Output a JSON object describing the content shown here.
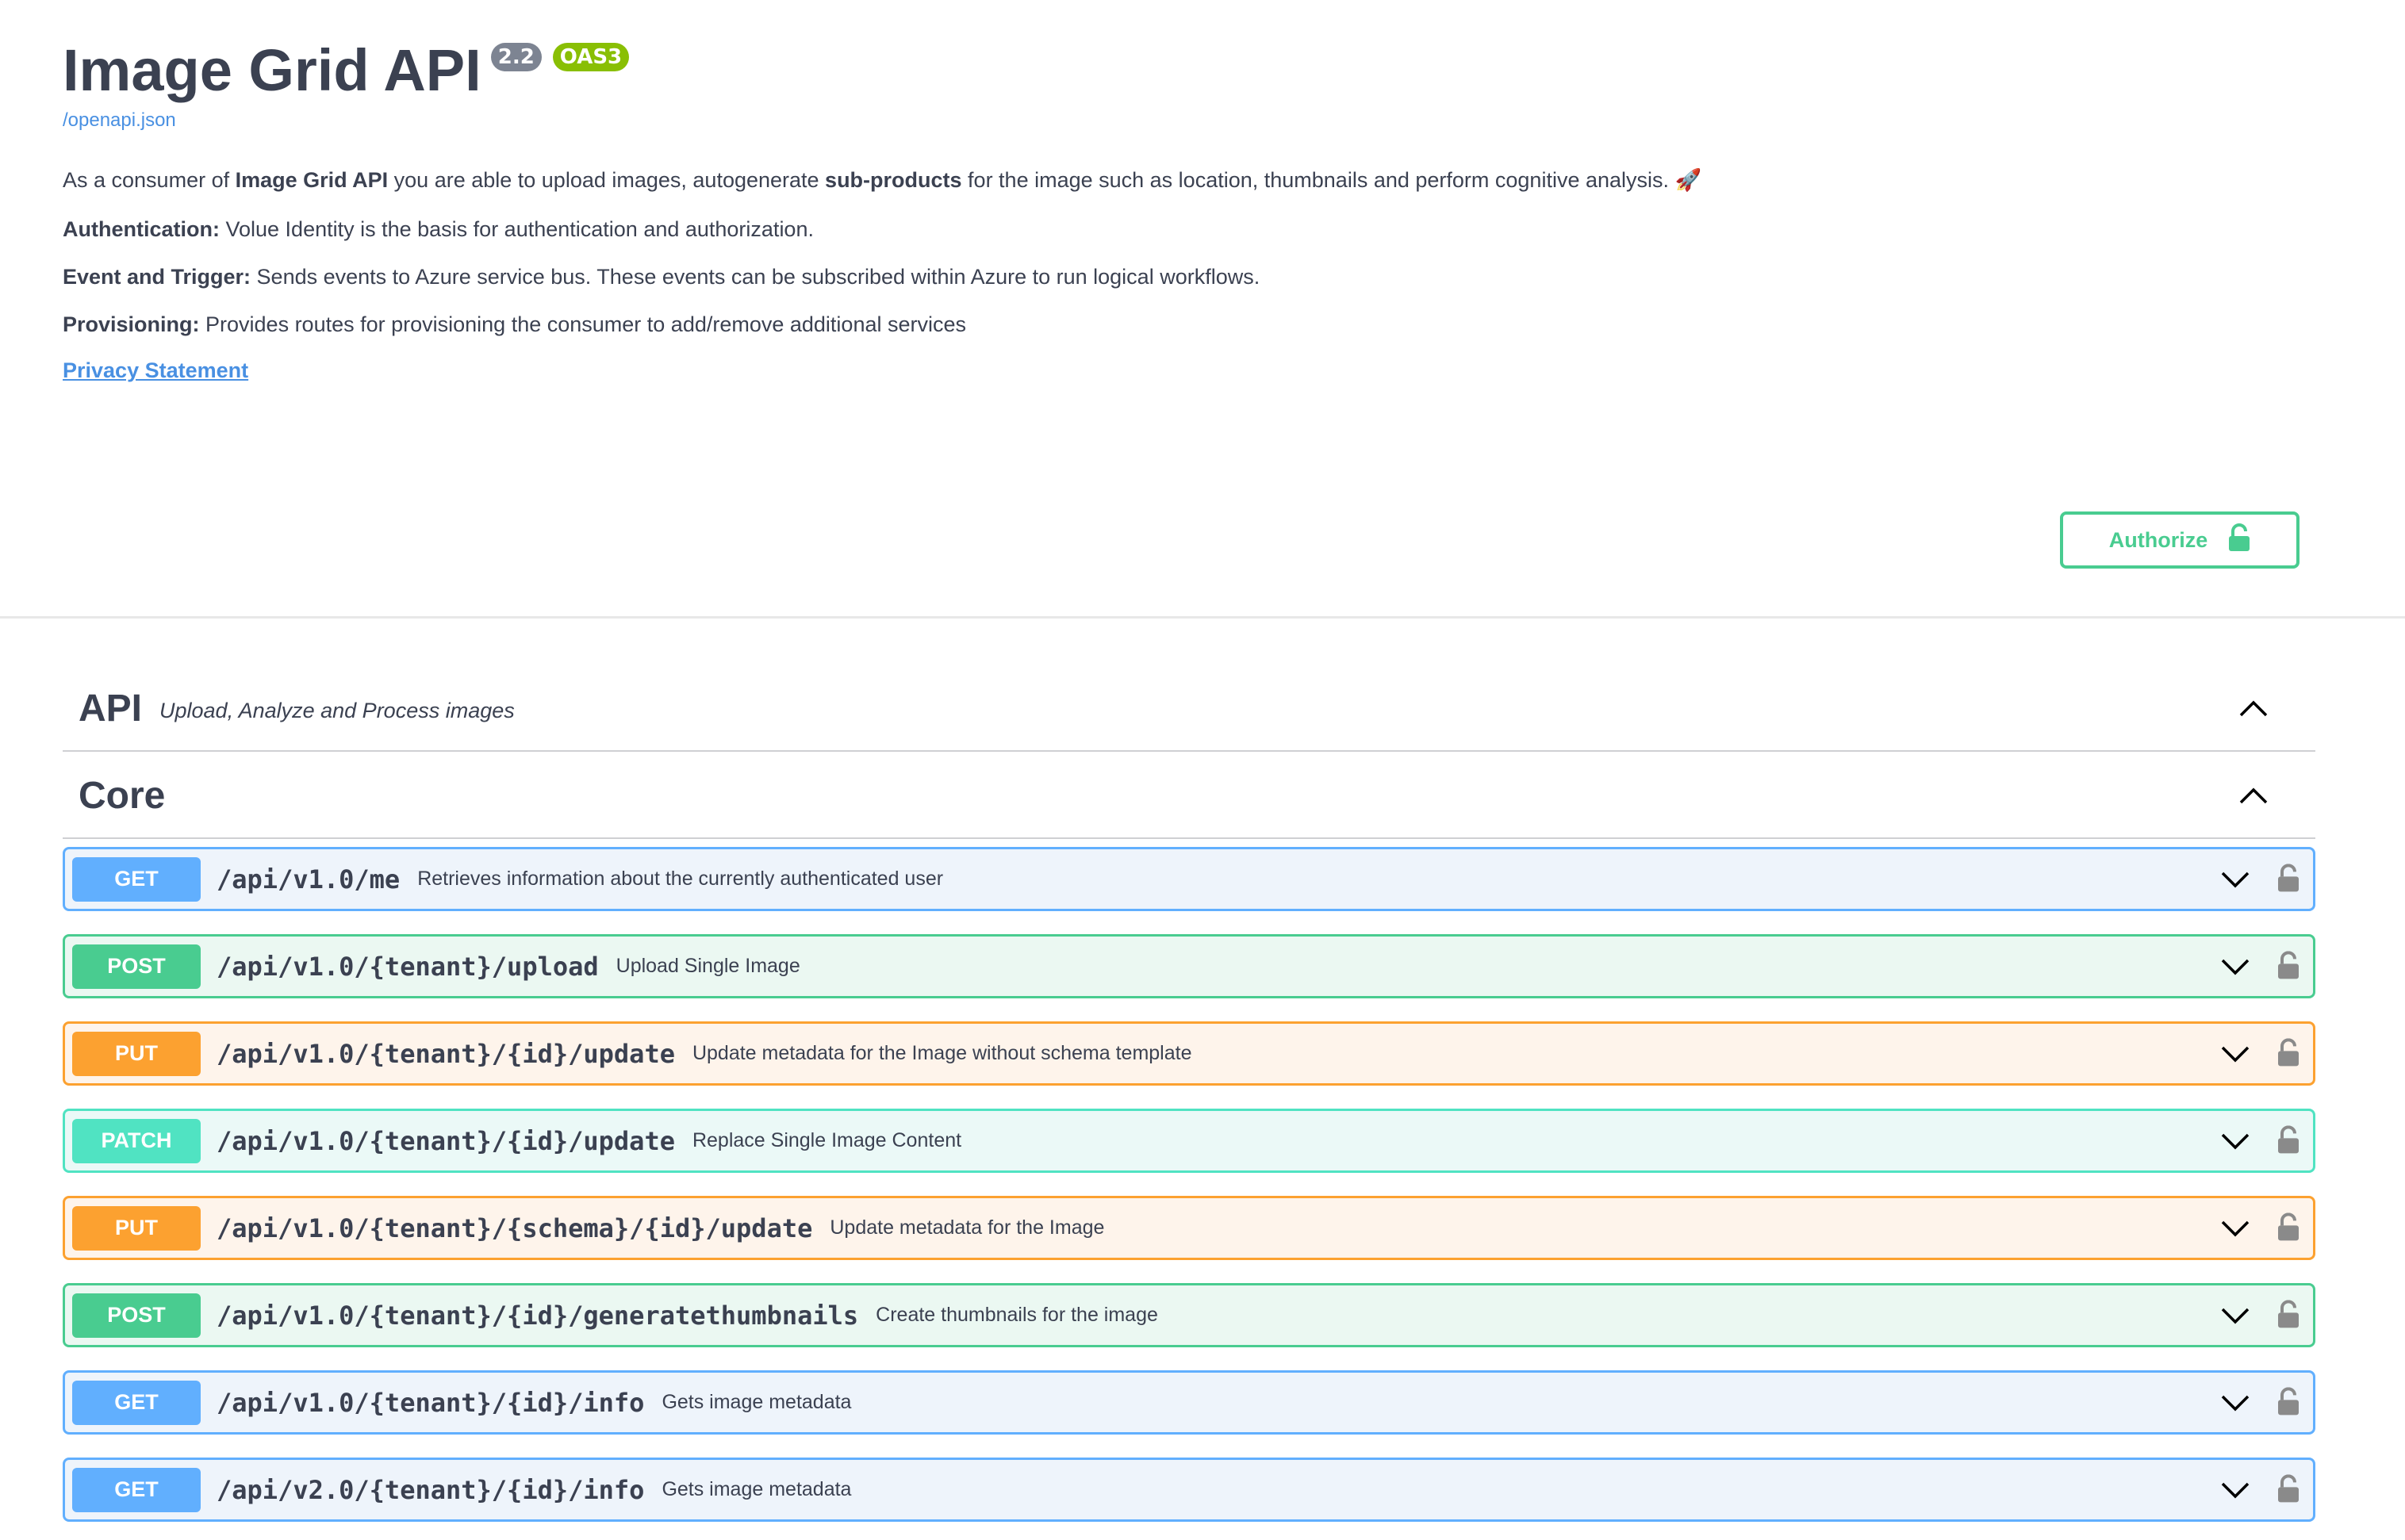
{
  "info": {
    "title": "Image Grid API",
    "version_badge": "2.2",
    "oas_badge": "OAS3",
    "spec_link": "/openapi.json",
    "description": {
      "p1_pre": "As a consumer of ",
      "p1_bold1": "Image Grid API",
      "p1_mid": " you are able to upload images, autogenerate ",
      "p1_bold2": "sub-products",
      "p1_post": " for the image such as location, thumbnails and perform cognitive analysis. 🚀",
      "auth_label": "Authentication:",
      "auth_text": " Volue Identity is the basis for authentication and authorization.",
      "event_label": "Event and Trigger:",
      "event_text": " Sends events to Azure service bus. These events can be subscribed within Azure to run logical workflows.",
      "prov_label": "Provisioning:",
      "prov_text": " Provides routes for provisioning the consumer to add/remove additional services"
    },
    "privacy_link": "Privacy Statement"
  },
  "authorize_button": {
    "label": "Authorize",
    "icon": "unlocked-lock-icon"
  },
  "sections": [
    {
      "name": "API",
      "description": "Upload, Analyze and Process images",
      "expanded": true
    },
    {
      "name": "Core",
      "description": "",
      "expanded": true
    }
  ],
  "operations": [
    {
      "method": "GET",
      "path": "/api/v1.0/me",
      "summary": "Retrieves information about the currently authenticated user"
    },
    {
      "method": "POST",
      "path": "/api/v1.0/{tenant}/upload",
      "summary": "Upload Single Image"
    },
    {
      "method": "PUT",
      "path": "/api/v1.0/{tenant}/{id}/update",
      "summary": "Update metadata for the Image without schema template"
    },
    {
      "method": "PATCH",
      "path": "/api/v1.0/{tenant}/{id}/update",
      "summary": "Replace Single Image Content"
    },
    {
      "method": "PUT",
      "path": "/api/v1.0/{tenant}/{schema}/{id}/update",
      "summary": "Update metadata for the Image"
    },
    {
      "method": "POST",
      "path": "/api/v1.0/{tenant}/{id}/generatethumbnails",
      "summary": "Create thumbnails for the image"
    },
    {
      "method": "GET",
      "path": "/api/v1.0/{tenant}/{id}/info",
      "summary": "Gets image metadata"
    },
    {
      "method": "GET",
      "path": "/api/v2.0/{tenant}/{id}/info",
      "summary": "Gets image metadata"
    }
  ],
  "colors": {
    "get": "#61affe",
    "post": "#49cc90",
    "put": "#fca130",
    "patch": "#50e3c2",
    "link": "#4990e2",
    "authorize": "#49cc90",
    "text": "#3b4151"
  }
}
